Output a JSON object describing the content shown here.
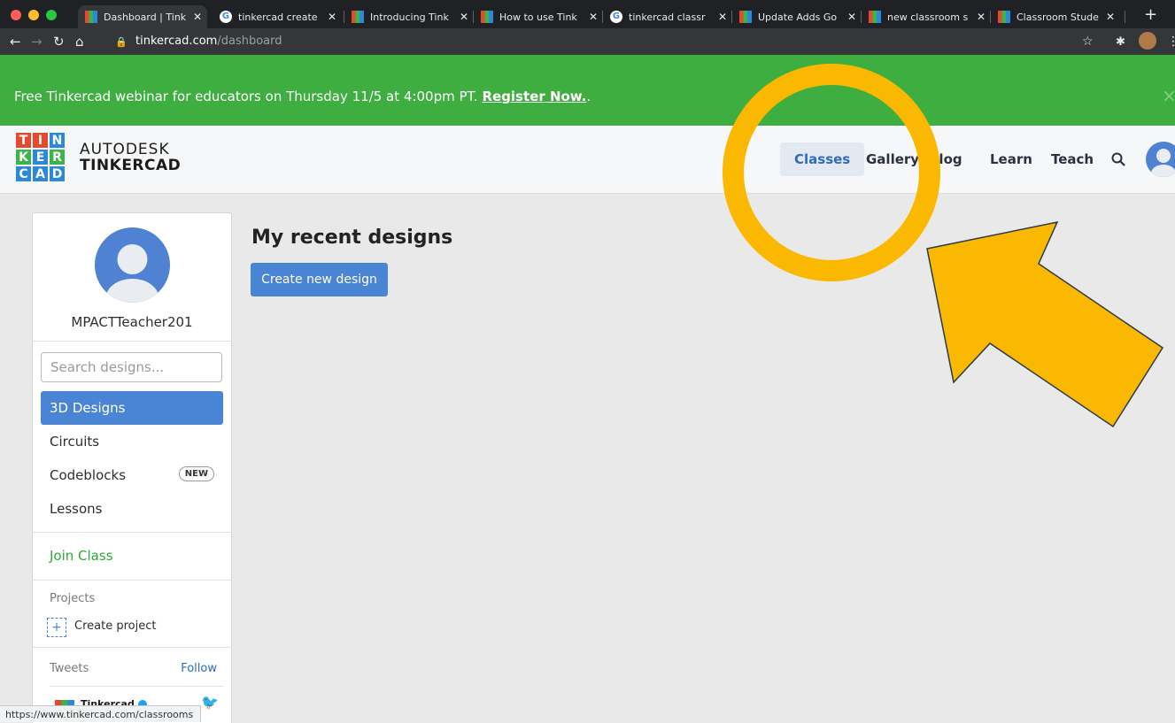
{
  "browser": {
    "tabs": [
      {
        "title": "Dashboard | Tink",
        "favicon": "tinkercad-icon",
        "active": true
      },
      {
        "title": "tinkercad create",
        "favicon": "google-icon"
      },
      {
        "title": "Introducing Tink",
        "favicon": "tinkercad-icon"
      },
      {
        "title": "How to use Tink",
        "favicon": "tinkercad-icon"
      },
      {
        "title": "tinkercad classr",
        "favicon": "google-icon"
      },
      {
        "title": "Update Adds Go",
        "favicon": "tinkercad-icon"
      },
      {
        "title": "new classroom s",
        "favicon": "tinkercad-icon"
      },
      {
        "title": "Classroom Stude",
        "favicon": "tinkercad-icon"
      }
    ],
    "new_tab": "+",
    "url_domain": "tinkercad.com",
    "url_path": "/dashboard",
    "status_url": "https://www.tinkercad.com/classrooms"
  },
  "banner": {
    "text": "Free Tinkercad webinar for educators on Thursday 11/5 at 4:00pm PT. ",
    "link": "Register Now.",
    "suffix": ".",
    "close": "×"
  },
  "header": {
    "logo_letters": [
      "T",
      "I",
      "N",
      "K",
      "E",
      "R",
      "C",
      "A",
      "D"
    ],
    "logo_colors": [
      "#e7492e",
      "#e7492e",
      "#2c88d9",
      "#3bb44a",
      "#2c88d9",
      "#3bb44a",
      "#2c88d9",
      "#2c88d9",
      "#2c88d9"
    ],
    "brand_top": "AUTODESK",
    "brand_bottom": "TINKERCAD",
    "nav": [
      "Classes",
      "Gallery",
      "Blog",
      "Learn",
      "Teach"
    ]
  },
  "sidebar": {
    "username": "MPACTTeacher201",
    "search_placeholder": "Search designs...",
    "items": [
      "3D Designs",
      "Circuits",
      "Codeblocks",
      "Lessons"
    ],
    "new_badge": "NEW",
    "join_class": "Join Class",
    "projects_label": "Projects",
    "create_project": "Create project",
    "tweets_label": "Tweets",
    "follow": "Follow",
    "tweet_user": "Tinkercad"
  },
  "main": {
    "title": "My recent designs",
    "create_button": "Create new design"
  },
  "colors": {
    "banner_green": "#3dae3f",
    "accent_blue": "#4a84d4",
    "annotation_yellow": "#fbb800"
  }
}
